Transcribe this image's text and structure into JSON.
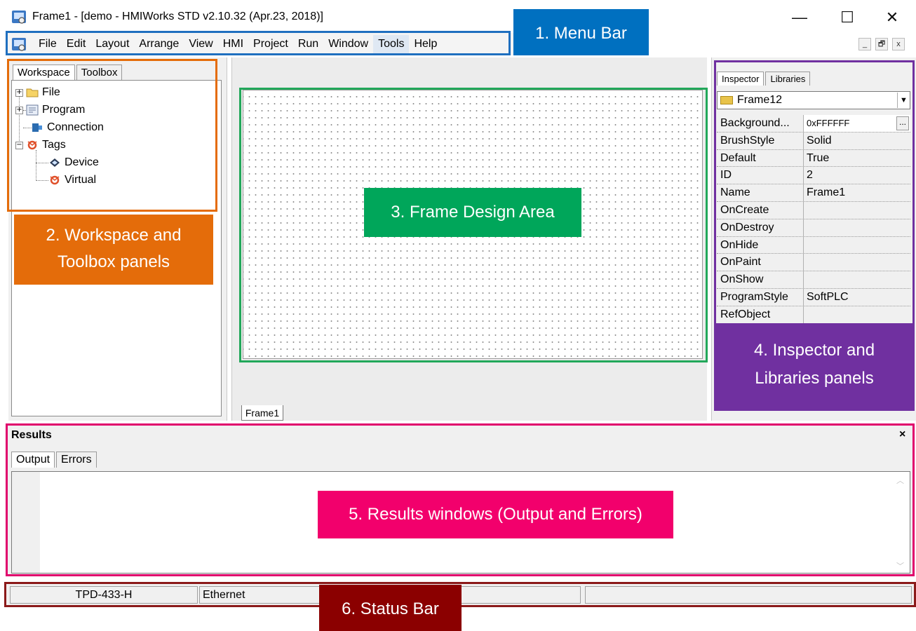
{
  "window": {
    "title": "Frame1 - [demo - HMIWorks STD v2.10.32 (Apr.23, 2018)]",
    "minimize_glyph": "—",
    "maximize_glyph": "☐",
    "close_glyph": "✕",
    "app_icon": "hmiworks-app-icon"
  },
  "menubar": {
    "items": [
      "File",
      "Edit",
      "Layout",
      "Arrange",
      "View",
      "HMI",
      "Project",
      "Run",
      "Window",
      "Tools",
      "Help"
    ],
    "active_item": "Tools",
    "mdi_minimize": "_",
    "mdi_restore": "🗗",
    "mdi_close": "x"
  },
  "workspace": {
    "tabs": [
      "Workspace",
      "Toolbox"
    ],
    "active_tab": "Workspace",
    "tree": {
      "file": "File",
      "program": "Program",
      "connection": "Connection",
      "tags": "Tags",
      "device": "Device",
      "virtual": "Virtual"
    }
  },
  "design": {
    "frame_tab": "Frame1"
  },
  "inspector": {
    "tabs": [
      "Inspector",
      "Libraries"
    ],
    "active_tab": "Inspector",
    "selected_object": "Frame12",
    "properties": [
      {
        "name": "Background...",
        "value": "0xFFFFFF"
      },
      {
        "name": "BrushStyle",
        "value": "Solid"
      },
      {
        "name": "Default",
        "value": "True"
      },
      {
        "name": "ID",
        "value": "2"
      },
      {
        "name": "Name",
        "value": "Frame1"
      },
      {
        "name": "OnCreate",
        "value": ""
      },
      {
        "name": "OnDestroy",
        "value": ""
      },
      {
        "name": "OnHide",
        "value": ""
      },
      {
        "name": "OnPaint",
        "value": ""
      },
      {
        "name": "OnShow",
        "value": ""
      },
      {
        "name": "ProgramStyle",
        "value": "SoftPLC"
      },
      {
        "name": "RefObject",
        "value": ""
      }
    ],
    "ellipsis": "..."
  },
  "results": {
    "title": "Results",
    "close": "×",
    "tabs": [
      "Output",
      "Errors"
    ],
    "active_tab": "Output"
  },
  "statusbar": {
    "device": "TPD-433-H",
    "connection": "Ethernet",
    "extra": ""
  },
  "annotations": {
    "menubar": "1. Menu Bar",
    "workspace_line1": "2. Workspace and",
    "workspace_line2": "Toolbox panels",
    "frame": "3. Frame Design Area",
    "inspector_line1": "4. Inspector and",
    "inspector_line2": "Libraries panels",
    "results": "5. Results windows (Output and Errors)",
    "status": "6. Status Bar"
  },
  "colors": {
    "menubar_callout": "#0070c0",
    "workspace_callout": "#e46c0a",
    "frame_callout": "#00a65a",
    "inspector_callout": "#7030a0",
    "results_callout": "#f2006c",
    "status_callout": "#8b0000"
  }
}
